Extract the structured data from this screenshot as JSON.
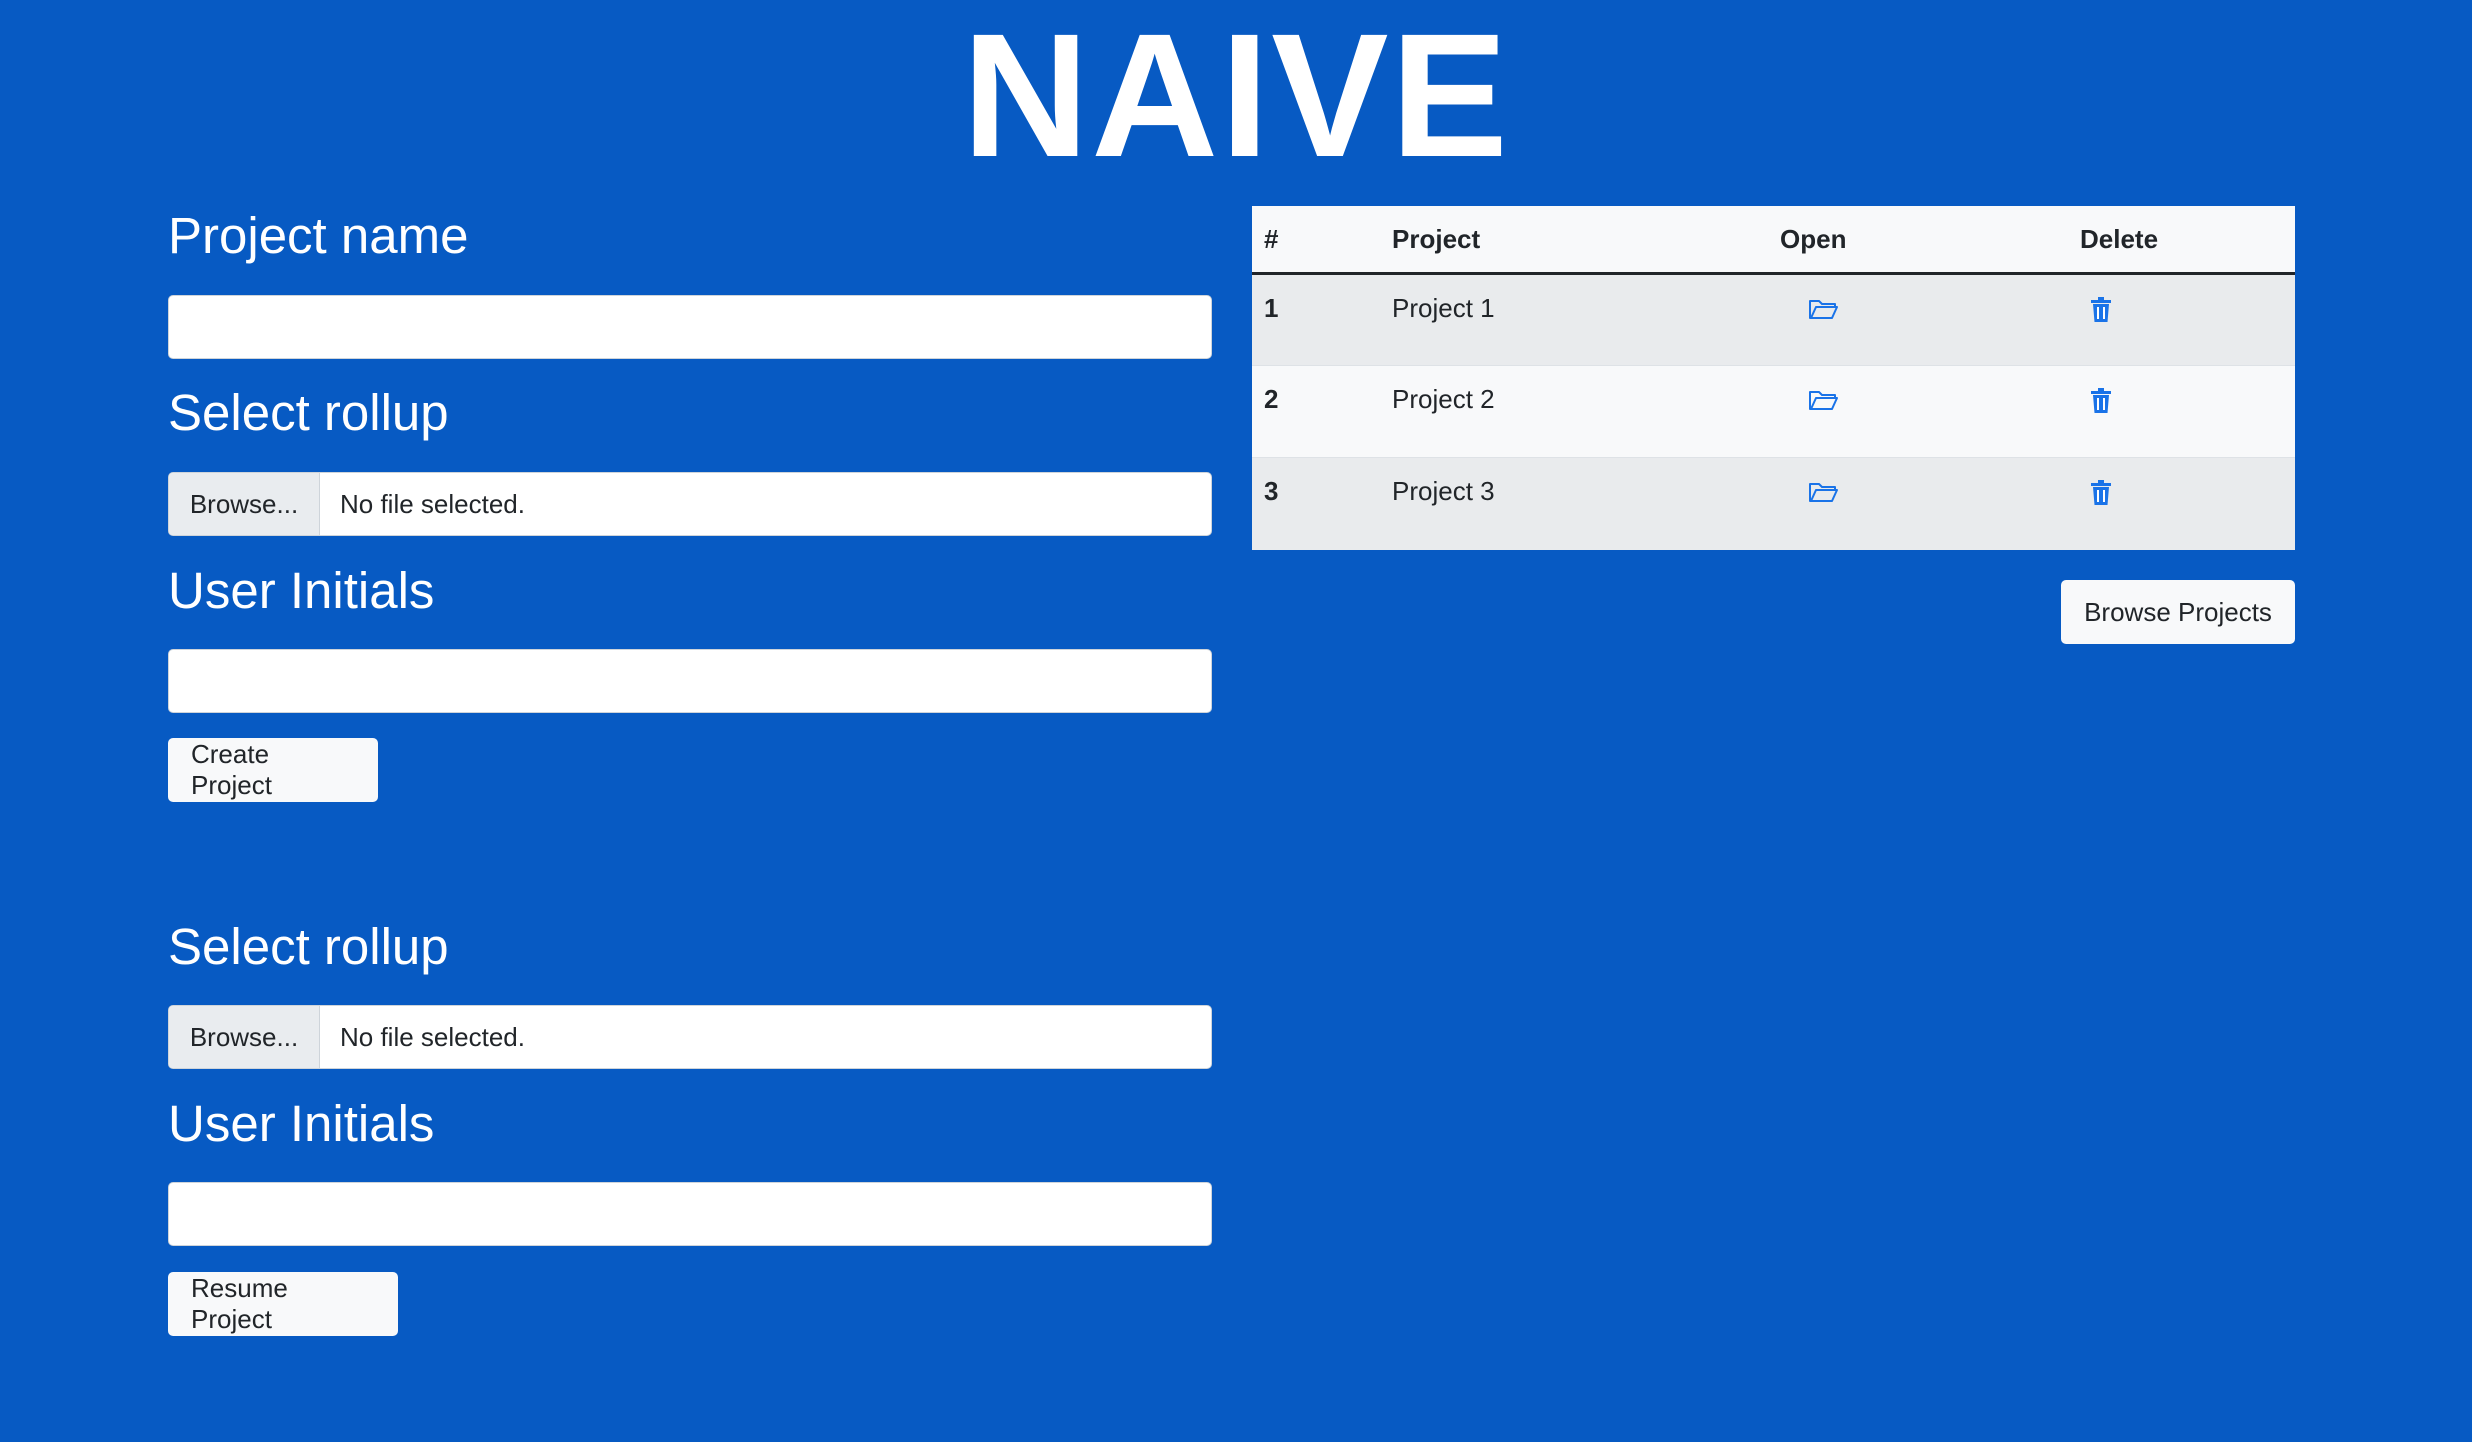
{
  "app": {
    "title": "NAIVE"
  },
  "create_form": {
    "project_name_label": "Project name",
    "project_name_value": "",
    "rollup_label": "Select rollup",
    "rollup_browse_label": "Browse...",
    "rollup_status": "No file selected.",
    "initials_label": "User Initials",
    "initials_value": "",
    "submit_label": "Create Project"
  },
  "resume_form": {
    "rollup_label": "Select rollup",
    "rollup_browse_label": "Browse...",
    "rollup_status": "No file selected.",
    "initials_label": "User Initials",
    "initials_value": "",
    "submit_label": "Resume Project"
  },
  "projects_table": {
    "headers": {
      "num": "#",
      "project": "Project",
      "open": "Open",
      "delete": "Delete"
    },
    "rows": [
      {
        "num": "1",
        "project": "Project 1"
      },
      {
        "num": "2",
        "project": "Project 2"
      },
      {
        "num": "3",
        "project": "Project 3"
      }
    ],
    "open_icon": "folder-open-icon",
    "delete_icon": "trash-icon",
    "icon_color": "#1a73e8"
  },
  "browse_projects_label": "Browse Projects",
  "colors": {
    "background": "#075ac3",
    "title": "#ffffff"
  }
}
